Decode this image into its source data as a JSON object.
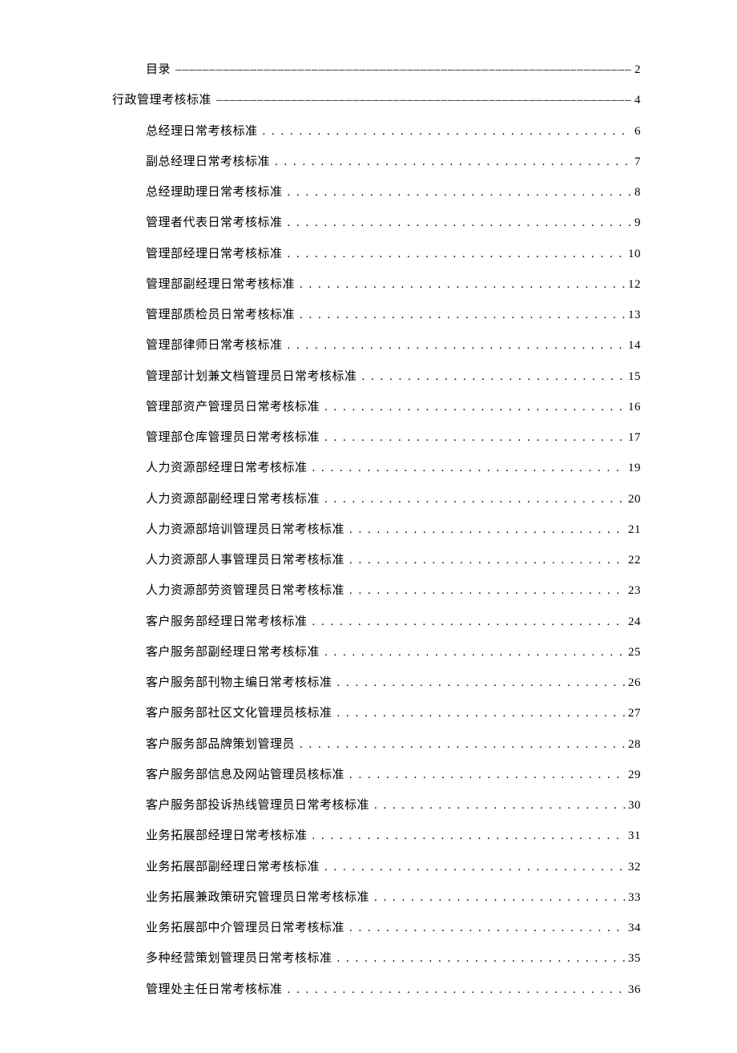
{
  "toc": [
    {
      "label": "目录",
      "page": "2",
      "leader": "dash",
      "indent": 1
    },
    {
      "label": "行政管理考核标准",
      "page": "4",
      "leader": "dash",
      "indent": 0
    },
    {
      "label": "总经理日常考核标准",
      "page": "6",
      "leader": "dot",
      "indent": 2
    },
    {
      "label": "副总经理日常考核标准",
      "page": "7",
      "leader": "dot",
      "indent": 2
    },
    {
      "label": "总经理助理日常考核标准",
      "page": "8",
      "leader": "dot",
      "indent": 2
    },
    {
      "label": "管理者代表日常考核标准",
      "page": "9",
      "leader": "dot",
      "indent": 2
    },
    {
      "label": "管理部经理日常考核标准",
      "page": "10",
      "leader": "dot",
      "indent": 2
    },
    {
      "label": "管理部副经理日常考核标准",
      "page": "12",
      "leader": "dot",
      "indent": 2
    },
    {
      "label": "管理部质检员日常考核标准",
      "page": "13",
      "leader": "dot",
      "indent": 2
    },
    {
      "label": "管理部律师日常考核标准",
      "page": "14",
      "leader": "dot",
      "indent": 2
    },
    {
      "label": "管理部计划兼文档管理员日常考核标准",
      "page": "15",
      "leader": "dot",
      "indent": 2
    },
    {
      "label": "管理部资产管理员日常考核标准",
      "page": "16",
      "leader": "dot",
      "indent": 2
    },
    {
      "label": "管理部仓库管理员日常考核标准",
      "page": "17",
      "leader": "dot",
      "indent": 2
    },
    {
      "label": "人力资源部经理日常考核标准",
      "page": "19",
      "leader": "dot",
      "indent": 2
    },
    {
      "label": "人力资源部副经理日常考核标准",
      "page": "20",
      "leader": "dot",
      "indent": 2
    },
    {
      "label": "人力资源部培训管理员日常考核标准",
      "page": "21",
      "leader": "dot",
      "indent": 2
    },
    {
      "label": "人力资源部人事管理员日常考核标准",
      "page": "22",
      "leader": "dot",
      "indent": 2
    },
    {
      "label": "人力资源部劳资管理员日常考核标准",
      "page": "23",
      "leader": "dot",
      "indent": 2
    },
    {
      "label": "客户服务部经理日常考核标准",
      "page": "24",
      "leader": "dot",
      "indent": 2
    },
    {
      "label": "客户服务部副经理日常考核标准",
      "page": "25",
      "leader": "dot",
      "indent": 2
    },
    {
      "label": "客户服务部刊物主编日常考核标准",
      "page": "26",
      "leader": "dot",
      "indent": 2
    },
    {
      "label": "客户服务部社区文化管理员核标准",
      "page": "27",
      "leader": "dot",
      "indent": 2
    },
    {
      "label": "客户服务部品牌策划管理员",
      "page": "28",
      "leader": "dot",
      "indent": 2
    },
    {
      "label": "客户服务部信息及网站管理员核标准",
      "page": "29",
      "leader": "dot",
      "indent": 2
    },
    {
      "label": "客户服务部投诉热线管理员日常考核标准",
      "page": "30",
      "leader": "dot",
      "indent": 2
    },
    {
      "label": "业务拓展部经理日常考核标准",
      "page": "31",
      "leader": "dot",
      "indent": 2
    },
    {
      "label": "业务拓展部副经理日常考核标准",
      "page": "32",
      "leader": "dot",
      "indent": 2
    },
    {
      "label": "业务拓展兼政策研究管理员日常考核标准",
      "page": "33",
      "leader": "dot",
      "indent": 2
    },
    {
      "label": "业务拓展部中介管理员日常考核标准",
      "page": "34",
      "leader": "dot",
      "indent": 2
    },
    {
      "label": "多种经营策划管理员日常考核标准",
      "page": "35",
      "leader": "dot",
      "indent": 2
    },
    {
      "label": "管理处主任日常考核标准",
      "page": "36",
      "leader": "dot",
      "indent": 2
    }
  ]
}
